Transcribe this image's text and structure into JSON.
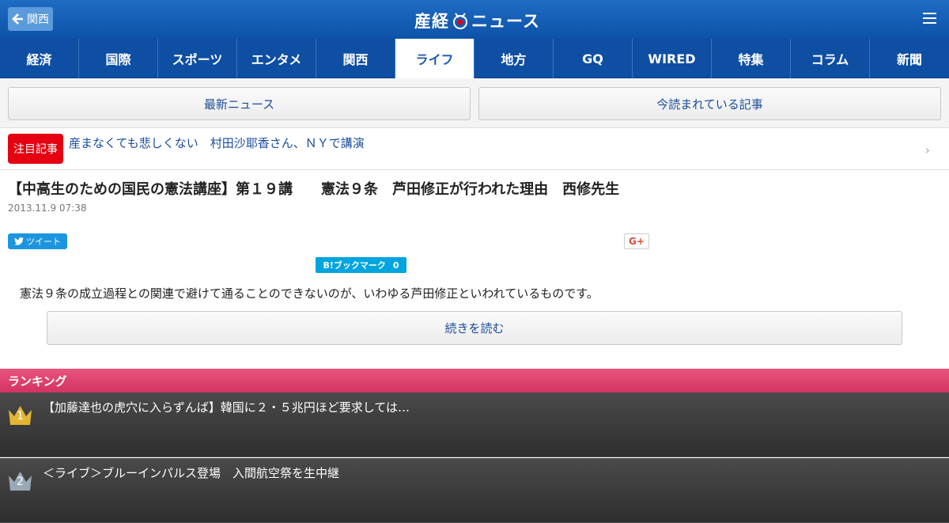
{
  "header": {
    "back_label": "関西",
    "logo_text_left": "産経",
    "logo_text_right": "ニュース"
  },
  "tabs": [
    {
      "label": "経済"
    },
    {
      "label": "国際"
    },
    {
      "label": "スポーツ"
    },
    {
      "label": "エンタメ"
    },
    {
      "label": "関西"
    },
    {
      "label": "ライフ",
      "active": true
    },
    {
      "label": "地方"
    },
    {
      "label": "GQ"
    },
    {
      "label": "WIRED"
    },
    {
      "label": "特集"
    },
    {
      "label": "コラム"
    },
    {
      "label": "新聞"
    }
  ],
  "buttons": {
    "latest": "最新ニュース",
    "popular": "今読まれている記事"
  },
  "attention": {
    "badge": "注目記事",
    "text": "産まなくても悲しくない　村田沙耶香さん、ＮＹで講演"
  },
  "article": {
    "title": "【中高生のための国民の憲法講座】第１９講　　憲法９条　芦田修正が行われた理由　西修先生",
    "date": "2013.11.9 07:38",
    "lead": "憲法９条の成立過程との関連で避けて通ることのできないのが、いわゆる芦田修正といわれているものです。",
    "read_more": "続きを読む"
  },
  "social": {
    "tweet": "ツイート",
    "gplus": "G+",
    "hatena": "B!ブックマーク",
    "hatena_count": "0"
  },
  "ranking": {
    "title": "ランキング",
    "items": [
      {
        "rank": "1",
        "text": "【加藤達也の虎穴に入らずんば】韓国に２・５兆円ほど要求しては…",
        "crown_color": "#e2b533"
      },
      {
        "rank": "2",
        "text": "＜ライブ＞ブルーインパルス登場　入間航空祭を生中継",
        "crown_color": "#9aa9b8"
      }
    ]
  },
  "colors": {
    "header": "#0d52a8",
    "accent_red": "#e50012",
    "ranking_pink": "#d33360"
  }
}
